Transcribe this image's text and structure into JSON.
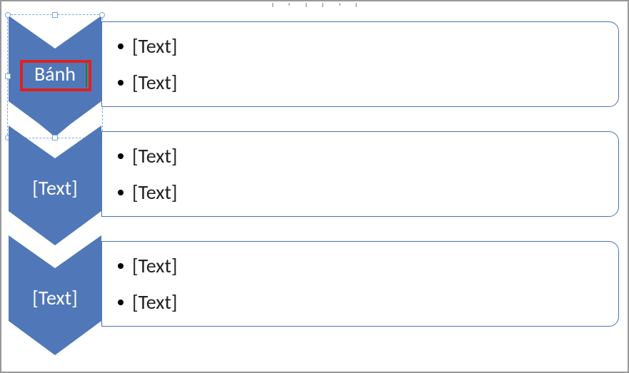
{
  "colors": {
    "accent": "#5078b8",
    "border": "#4a72b8",
    "highlight": "#e02020"
  },
  "rows": [
    {
      "chevron_label": "Bánh",
      "selected": true,
      "bullets": [
        "[Text]",
        "[Text]"
      ]
    },
    {
      "chevron_label": "[Text]",
      "selected": false,
      "bullets": [
        "[Text]",
        "[Text]"
      ]
    },
    {
      "chevron_label": "[Text]",
      "selected": false,
      "bullets": [
        "[Text]",
        "[Text]"
      ]
    }
  ]
}
